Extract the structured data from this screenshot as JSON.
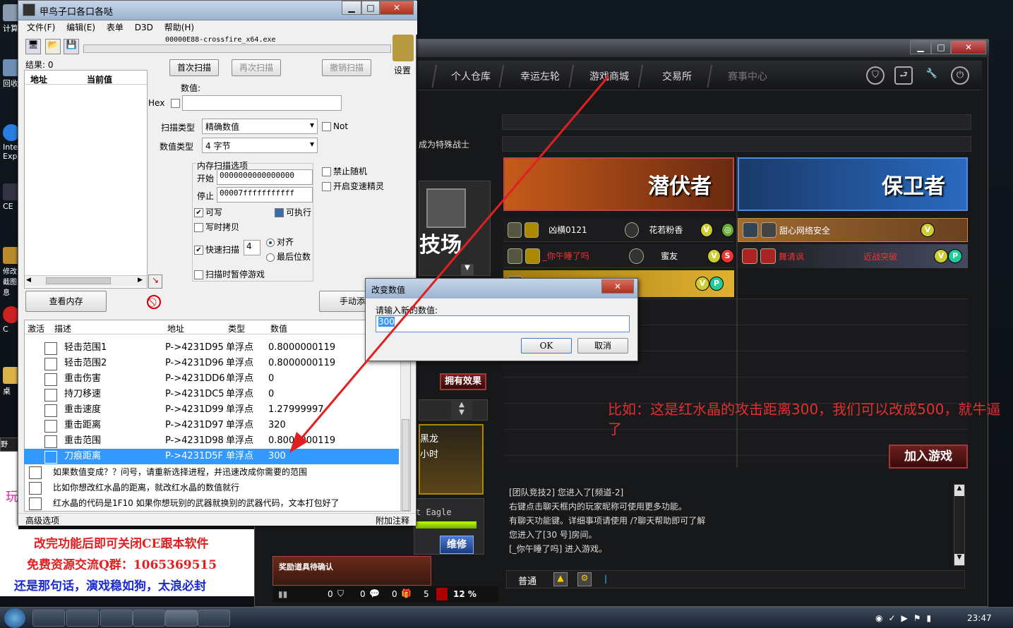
{
  "desktop": {
    "icons": [
      "计算",
      "回收",
      "Inte\nExpl",
      "CE",
      "修改截图息",
      "C",
      "桌"
    ],
    "left_red_text": "玩"
  },
  "game": {
    "nav": [
      "个人仓库",
      "幸运左轮",
      "游戏商城",
      "交易所",
      "赛事中心"
    ],
    "notice": "成为特殊战士",
    "arena_text": "技场",
    "banner_left": "潜伏者",
    "banner_right": "保卫者",
    "players_left": [
      {
        "name": "凶横0121",
        "rank_name": "花若粉香"
      },
      {
        "name": "_你午睡了吗",
        "rank_name": "蜜友"
      }
    ],
    "players_right": [
      {
        "name": "甜心网络安全"
      },
      {
        "name": "舞清讽",
        "extra": "近战突破"
      }
    ],
    "effect_btn": "拥有效果",
    "join_btn": "加入游戏",
    "repair_btn": "维修",
    "weapon_name": "黑龙",
    "weapon_sub": "小时",
    "weapon_eagle": "t Eagle",
    "reward_text": "奖励道具待确认",
    "status": {
      "a": "0",
      "b": "0",
      "c": "0",
      "d": "5",
      "pct": "12 %"
    },
    "chat_lines": [
      "[团队竞技2] 您进入了[频道-2]",
      "右键点击聊天框内的玩家昵称可使用更多功能。",
      "有聊天功能键。详细事项请使用 /?聊天帮助即可了解",
      "您进入了[30 号]房间。",
      "[_你午睡了吗] 进入游戏。"
    ],
    "chat_mode": "普通",
    "annotation": "比如：这是红水晶的攻击距离300，我们可以改成500，就牛逼了"
  },
  "ce": {
    "title": "甲鸟子口各口各哒",
    "menu": [
      "文件(F)",
      "编辑(E)",
      "表单",
      "D3D",
      "帮助(H)"
    ],
    "process": "00000E88-crossfire_x64.exe",
    "settings": "设置",
    "results": "结果: 0",
    "list_headers": [
      "地址",
      "当前值"
    ],
    "first_scan": "首次扫描",
    "next_scan": "再次扫描",
    "undo_scan": "撤销扫描",
    "value_label": "数值:",
    "hex_label": "Hex",
    "scan_type_label": "扫描类型",
    "scan_type": "精确数值",
    "not_label": "Not",
    "value_type_label": "数值类型",
    "value_type": "4 字节",
    "mem_options": "内存扫描选项",
    "start_label": "开始",
    "start_value": "0000000000000000",
    "stop_label": "停止",
    "stop_value": "00007fffffffffff",
    "writable": "可写",
    "executable": "可执行",
    "copy_on_write": "写时拷贝",
    "fast_scan": "快速扫描",
    "fast_value": "4",
    "align": "对齐",
    "last_digit": "最后位数",
    "pause_game": "扫描时暂停游戏",
    "no_random": "禁止随机",
    "speedhack": "开启变速精灵",
    "view_memory": "查看内存",
    "manual_add": "手动添",
    "table_headers": [
      "激活",
      "描述",
      "地址",
      "类型",
      "数值"
    ],
    "rows": [
      {
        "desc": "轻击范围1",
        "addr": "P->4231D95",
        "type": "单浮点",
        "value": "0.8000000119"
      },
      {
        "desc": "轻击范围2",
        "addr": "P->4231D96",
        "type": "单浮点",
        "value": "0.8000000119"
      },
      {
        "desc": "重击伤害",
        "addr": "P->4231DD6",
        "type": "单浮点",
        "value": "0"
      },
      {
        "desc": "持刀移速",
        "addr": "P->4231DC5",
        "type": "单浮点",
        "value": "0"
      },
      {
        "desc": "重击速度",
        "addr": "P->4231D99",
        "type": "单浮点",
        "value": "1.27999997"
      },
      {
        "desc": "重击距离",
        "addr": "P->4231D97",
        "type": "单浮点",
        "value": "320"
      },
      {
        "desc": "重击范围",
        "addr": "P->4231D98",
        "type": "单浮点",
        "value": "0.8000000119"
      },
      {
        "desc": "刀痕距离",
        "addr": "P->4231D5F",
        "type": "单浮点",
        "value": "300"
      }
    ],
    "notes": [
      "如果数值变成？？问号，请重新选择进程，并迅速改成你需要的范围",
      "比如你想改红水晶的距离，就改红水晶的数值就行",
      "红水晶的代码是1F10 如果你想玩别的武器就换别的武器代码，文本打包好了"
    ],
    "advanced": "高级选项",
    "attach_comment": "附加注释"
  },
  "dialog": {
    "title": "改变数值",
    "prompt": "请输入新的数值:",
    "value": "300",
    "ok": "OK",
    "cancel": "取消"
  },
  "promo": [
    "改完功能后即可关闭CE跟本软件",
    "免费资源交流Q群：1065369515",
    "还是那句话，演戏稳如狗，太浪必封"
  ],
  "taskbar": {
    "time": "23:47"
  },
  "colors": {
    "selection": "#3399ff",
    "annotation": "#e03030",
    "promo_red": "#e02020",
    "promo_blue": "#1a2ad0"
  }
}
